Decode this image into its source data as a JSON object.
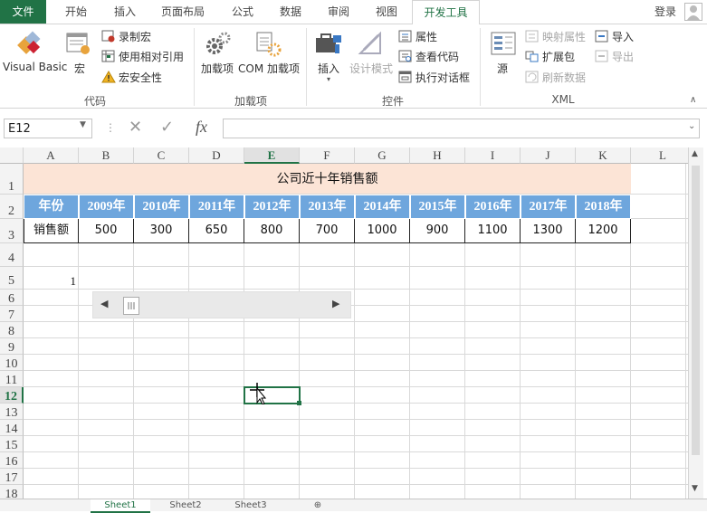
{
  "tabs": [
    "文件",
    "开始",
    "插入",
    "页面布局",
    "公式",
    "数据",
    "审阅",
    "视图",
    "开发工具"
  ],
  "login": "登录",
  "ribbon": {
    "code_group": {
      "label": "代码",
      "visual_basic": "Visual Basic",
      "macros": "宏",
      "record_macro": "录制宏",
      "relative_ref": "使用相对引用",
      "macro_security": "宏安全性"
    },
    "addins_group": {
      "label": "加载项",
      "addins": "加载项",
      "com_addins": "COM 加载项"
    },
    "controls_group": {
      "label": "控件",
      "insert": "插入",
      "design_mode": "设计模式",
      "properties": "属性",
      "view_code": "查看代码",
      "run_dialog": "执行对话框"
    },
    "xml_group": {
      "label": "XML",
      "source": "源",
      "map_props": "映射属性",
      "expansion_packs": "扩展包",
      "refresh_data": "刷新数据",
      "import": "导入",
      "export": "导出"
    }
  },
  "formula_bar": {
    "name_box": "E12",
    "fx": "fx",
    "value": ""
  },
  "columns": [
    "A",
    "B",
    "C",
    "D",
    "E",
    "F",
    "G",
    "H",
    "I",
    "J",
    "K",
    "L"
  ],
  "rows": [
    "1",
    "2",
    "3",
    "4",
    "5",
    "6",
    "7",
    "8",
    "9",
    "10",
    "11",
    "12",
    "13",
    "14",
    "15",
    "16",
    "17",
    "18"
  ],
  "selected_cell": {
    "col": "E",
    "row": "12"
  },
  "sheet": {
    "title": "公司近十年销售额",
    "header_label": "年份",
    "years": [
      "2009年",
      "2010年",
      "2011年",
      "2012年",
      "2013年",
      "2014年",
      "2015年",
      "2016年",
      "2017年",
      "2018年"
    ],
    "row_label": "销售额",
    "values": [
      "500",
      "300",
      "650",
      "800",
      "700",
      "1000",
      "900",
      "1100",
      "1300",
      "1200"
    ],
    "a5_value": "1"
  },
  "scrollbar_control": {
    "value": 1
  },
  "sheet_tabs": [
    "Sheet1",
    "Sheet2",
    "Sheet3"
  ],
  "colors": {
    "accent": "#217346",
    "header_fill": "#6ea6dd",
    "title_fill": "#fce4d6"
  }
}
